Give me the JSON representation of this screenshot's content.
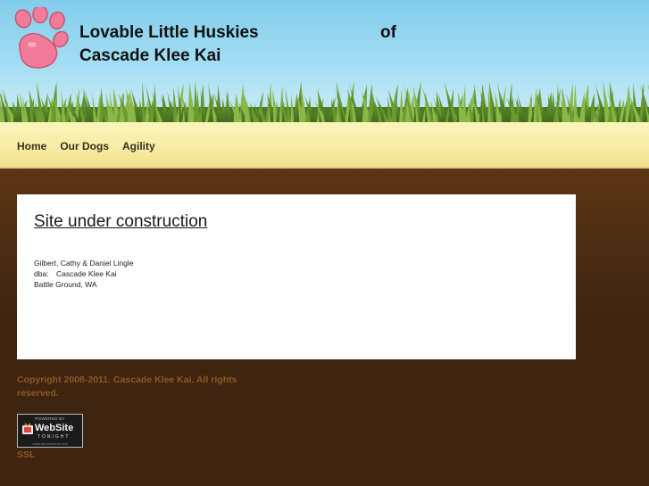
{
  "header": {
    "title_line1": "Lovable Little Huskies",
    "title_of": "of",
    "title_line2": "Cascade Klee Kai",
    "logo_icon": "paw-print-icon",
    "colors": {
      "sky": "#80cdeb",
      "paw_pink": "#f27a9a",
      "grass": "#5d8a2a"
    }
  },
  "nav": {
    "items": [
      {
        "label": "Home"
      },
      {
        "label": "Our Dogs"
      },
      {
        "label": "Agility"
      }
    ]
  },
  "content": {
    "heading": "Site under construction",
    "address_lines": [
      "Gilbert, Cathy & Daniel Lingle",
      "dba:",
      "Cascade Klee Kai",
      "Battle Ground, WA"
    ]
  },
  "footer": {
    "copyright": "Copyright 2008-2011. Cascade Klee Kai. All rights reserved.",
    "badge": {
      "powered": "POWERED BY",
      "website": "WebSite",
      "tonight": "TONIGHT",
      "url": "www.secureserver.net"
    },
    "ssl_link": "SSL",
    "text_color": "#8a5a22"
  }
}
